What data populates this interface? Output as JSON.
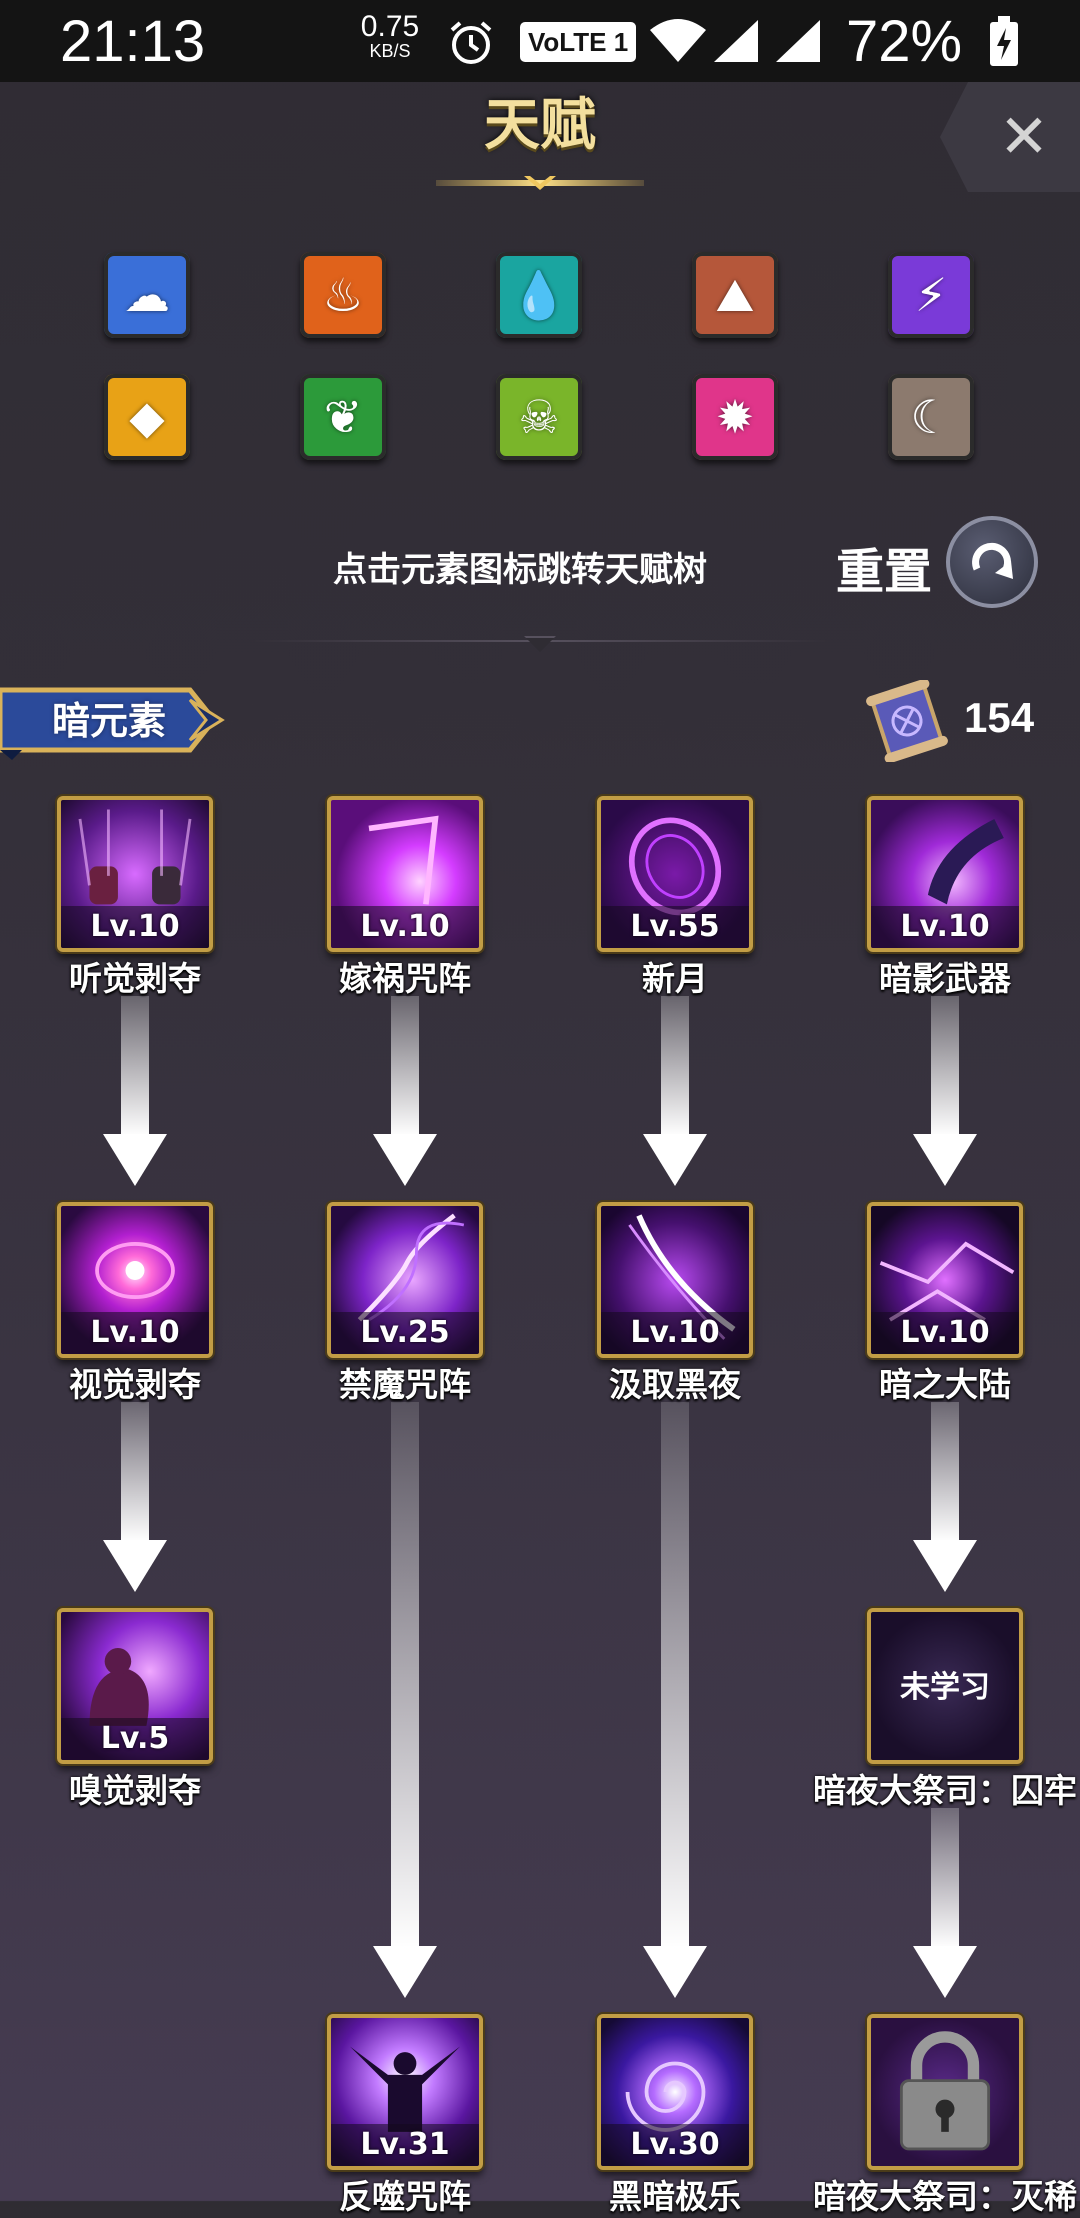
{
  "status_bar": {
    "time": "21:13",
    "speed_value": "0.75",
    "speed_unit": "KB/S",
    "volte": "VoLTE 1",
    "battery": "72%"
  },
  "header": {
    "title": "天赋",
    "close_glyph": "✕"
  },
  "elements": [
    {
      "name": "wind",
      "color": "#3a6fd8",
      "glyph": "☁"
    },
    {
      "name": "fire",
      "color": "#e0621b",
      "glyph": "♨"
    },
    {
      "name": "water",
      "color": "#1aa5a0",
      "glyph": "💧"
    },
    {
      "name": "earth",
      "color": "#b5573a",
      "glyph": "⛰"
    },
    {
      "name": "thunder",
      "color": "#7a3ad8",
      "glyph": "⚡"
    },
    {
      "name": "light",
      "color": "#e8a216",
      "glyph": "◆"
    },
    {
      "name": "nature",
      "color": "#2c9a3a",
      "glyph": "❦"
    },
    {
      "name": "poison",
      "color": "#7ab52a",
      "glyph": "☠"
    },
    {
      "name": "holy",
      "color": "#e0358a",
      "glyph": "✹"
    },
    {
      "name": "moon",
      "color": "#8c7a6e",
      "glyph": "☾"
    }
  ],
  "hint_text": "点击元素图标跳转天赋树",
  "reset_label": "重置",
  "reset_glyph": "↻",
  "section": {
    "name": "暗元素",
    "points": "154"
  },
  "skills": [
    {
      "name": "听觉剥夺",
      "level": "Lv.10"
    },
    {
      "name": "嫁祸咒阵",
      "level": "Lv.10"
    },
    {
      "name": "新月",
      "level": "Lv.55"
    },
    {
      "name": "暗影武器",
      "level": "Lv.10"
    },
    {
      "name": "视觉剥夺",
      "level": "Lv.10"
    },
    {
      "name": "禁魔咒阵",
      "level": "Lv.25"
    },
    {
      "name": "汲取黑夜",
      "level": "Lv.10"
    },
    {
      "name": "暗之大陆",
      "level": "Lv.10"
    },
    {
      "name": "嗅觉剥夺",
      "level": "Lv.5"
    },
    {
      "name": "暗夜大祭司：囚牢",
      "status": "未学习"
    },
    {
      "name": "反噬咒阵",
      "level": "Lv.31"
    },
    {
      "name": "黑暗极乐",
      "level": "Lv.30"
    },
    {
      "name": "暗夜大祭司：灭稀"
    }
  ]
}
